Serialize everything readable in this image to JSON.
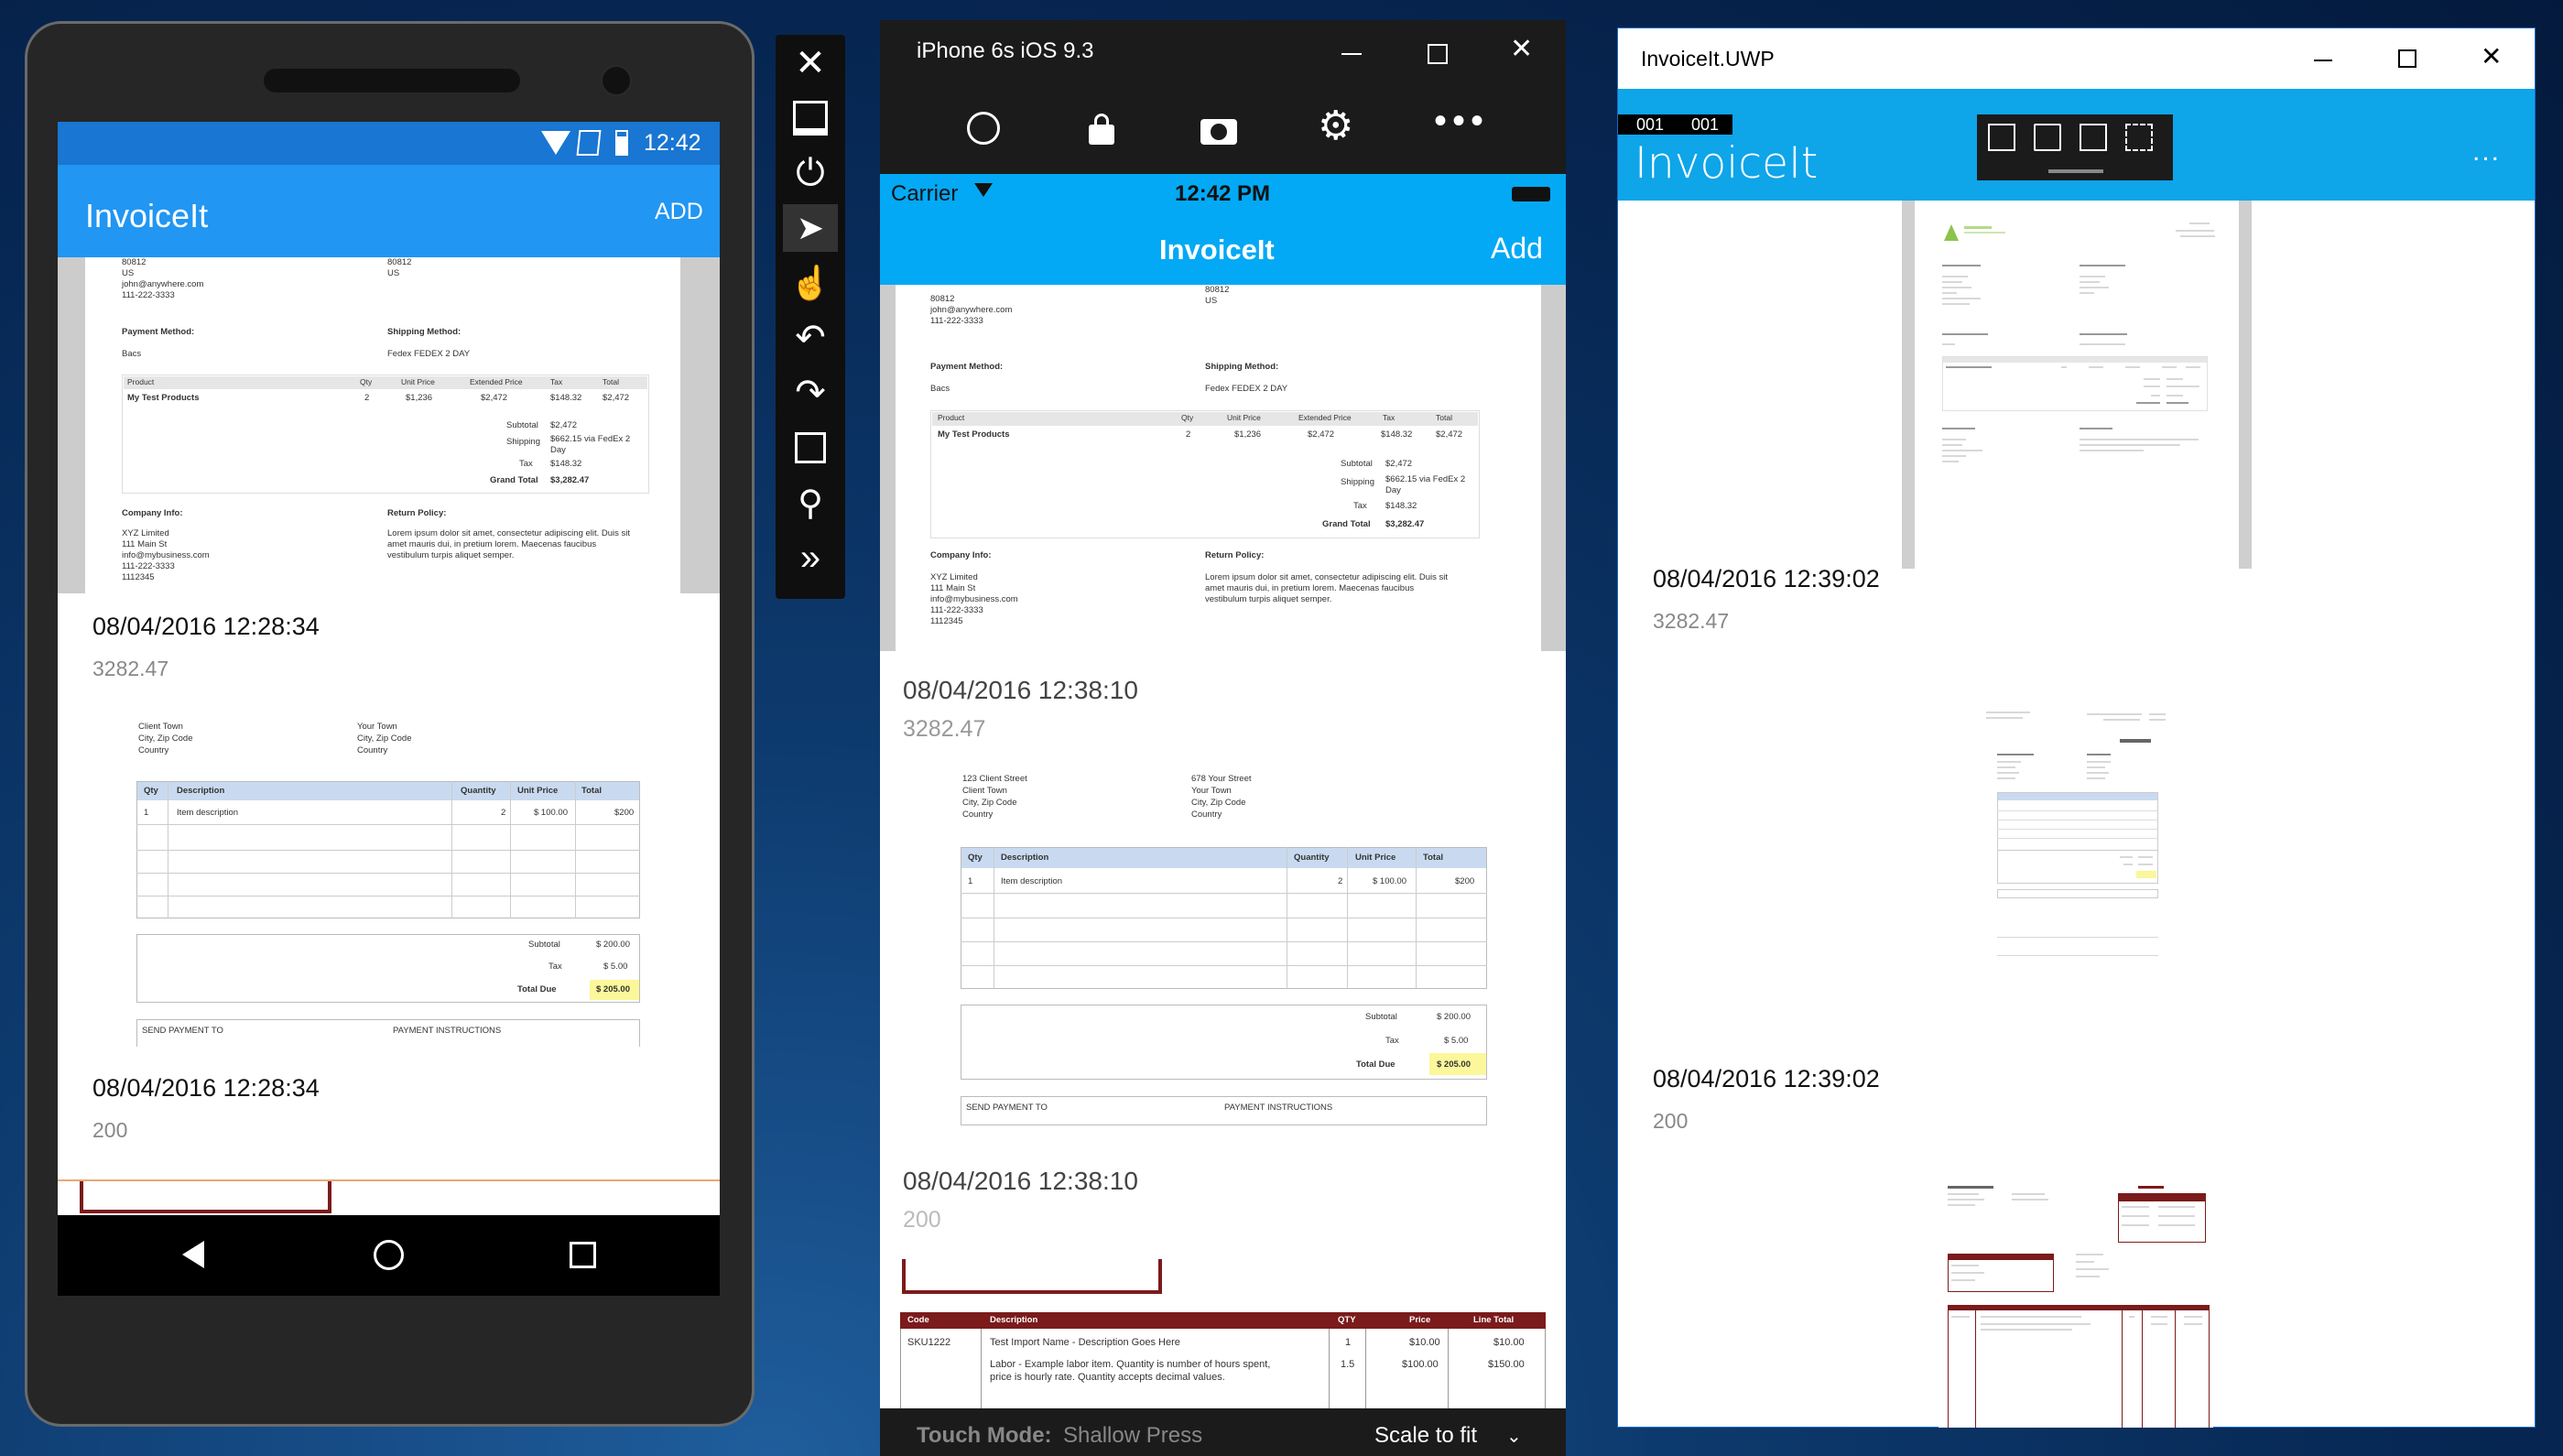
{
  "android": {
    "time": "12:42",
    "app_title": "InvoiceIt",
    "add_label": "ADD",
    "items": [
      {
        "date": "08/04/2016 12:28:34",
        "value": "3282.47"
      },
      {
        "date": "08/04/2016 12:28:34",
        "value": "200"
      }
    ]
  },
  "ios": {
    "window_title": "iPhone 6s iOS 9.3",
    "carrier": "Carrier",
    "time": "12:42 PM",
    "app_title": "InvoiceIt",
    "add_label": "Add",
    "items": [
      {
        "date": "08/04/2016 12:38:10",
        "value": "3282.47"
      },
      {
        "date": "08/04/2016 12:38:10",
        "value": "200"
      }
    ],
    "footer_mode_label": "Touch Mode:",
    "footer_mode_value": "Shallow Press",
    "footer_scale": "Scale to fit"
  },
  "uwp": {
    "window_title": "InvoiceIt.UWP",
    "counter_a": "001",
    "counter_b": "001",
    "app_title": "InvoiceIt",
    "more": "...",
    "items": [
      {
        "date": "08/04/2016 12:39:02",
        "value": "3282.47"
      },
      {
        "date": "08/04/2016 12:39:02",
        "value": "200"
      }
    ]
  },
  "invoice1": {
    "zip": "80812",
    "country": "US",
    "email": "john@anywhere.com",
    "phone": "111-222-3333",
    "ship_zip": "80812",
    "ship_country": "US",
    "payment_method_label": "Payment Method:",
    "payment_method": "Bacs",
    "shipping_method_label": "Shipping Method:",
    "shipping_method": "Fedex FEDEX 2 DAY",
    "headers": [
      "Product",
      "Qty",
      "Unit Price",
      "Extended Price",
      "Tax",
      "Total"
    ],
    "row": [
      "My Test Products",
      "2",
      "$1,236",
      "$2,472",
      "$148.32",
      "$2,472"
    ],
    "subtotal_label": "Subtotal",
    "subtotal": "$2,472",
    "shipping_label": "Shipping",
    "shipping": "$662.15 via FedEx 2 Day",
    "tax_label": "Tax",
    "tax": "$148.32",
    "grand_label": "Grand Total",
    "grand": "$3,282.47",
    "company_label": "Company Info:",
    "company_lines": [
      "XYZ Limited",
      "111 Main St",
      "info@mybusiness.com",
      "111-222-3333",
      "1112345"
    ],
    "return_label": "Return Policy:",
    "return_lines": [
      "Lorem ipsum dolor sit amet, consectetur adipiscing elit. Duis sit",
      "amet mauris dui, in pretium lorem. Maecenas faucibus",
      "vestibulum turpis aliquet semper."
    ]
  },
  "invoice2": {
    "client_lines": [
      "123 Client Street",
      "Client Town",
      "City, Zip Code",
      "Country"
    ],
    "your_lines": [
      "678 Your Street",
      "Your Town",
      "City, Zip Code",
      "Country"
    ],
    "headers": [
      "Qty",
      "Description",
      "Quantity",
      "Unit Price",
      "Total"
    ],
    "row": [
      "1",
      "Item description",
      "2",
      "$ 100.00",
      "$200"
    ],
    "subtotal_label": "Subtotal",
    "subtotal": "$ 200.00",
    "tax_label": "Tax",
    "tax": "$ 5.00",
    "total_label": "Total Due",
    "total": "$ 205.00",
    "send_label": "SEND PAYMENT TO",
    "instr_label": "PAYMENT INSTRUCTIONS"
  },
  "invoice3": {
    "headers": [
      "Code",
      "Description",
      "QTY",
      "Price",
      "Line Total"
    ],
    "row1": [
      "SKU1222",
      "Test Import Name - Description Goes Here",
      "1",
      "$10.00",
      "$10.00"
    ],
    "row2": [
      "",
      "Labor - Example labor item. Quantity is number of hours spent,",
      "1.5",
      "$100.00",
      "$150.00"
    ],
    "row2b": "price is hourly rate. Quantity accepts decimal values."
  },
  "colors": {
    "android_primary": "#2196f3",
    "ios_primary": "#03a9f4",
    "uwp_primary": "#0ea5e9",
    "maroon": "#7b1b1b"
  }
}
